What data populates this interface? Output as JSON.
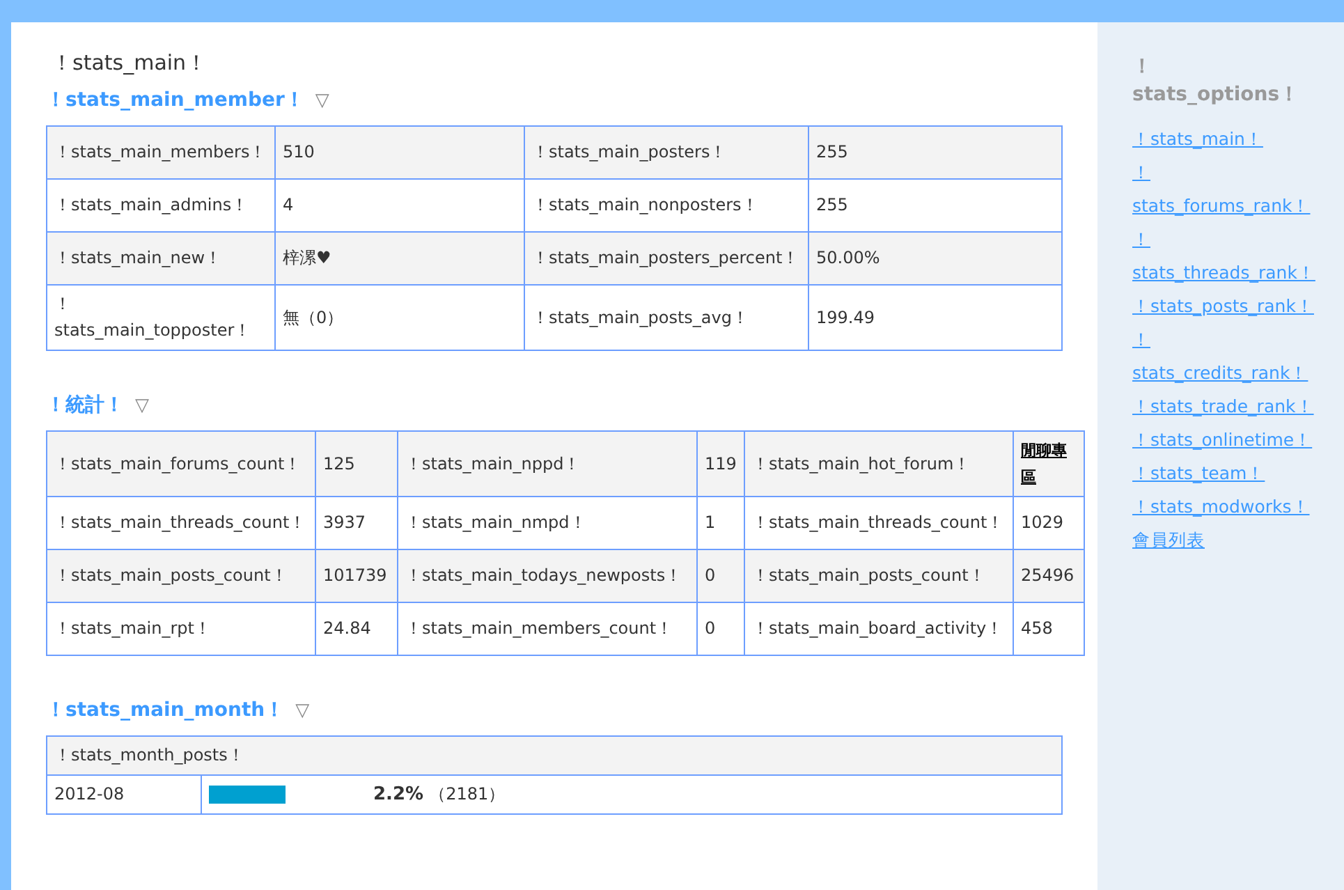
{
  "page_title": "！stats_main！",
  "member_section": {
    "title": "！stats_main_member！",
    "toggle": "▽",
    "rows": [
      [
        "！stats_main_members！",
        "510",
        "！stats_main_posters！",
        "255"
      ],
      [
        "！stats_main_admins！",
        "4",
        "！stats_main_nonposters！",
        "255"
      ],
      [
        "！stats_main_new！",
        "梓漯♥",
        "！stats_main_posters_percent！",
        "50.00%"
      ],
      [
        "！stats_main_topposter！",
        "無（0）",
        "！stats_main_posts_avg！",
        "199.49"
      ]
    ]
  },
  "stats_section": {
    "title": "！統計！",
    "toggle": "▽",
    "rows": [
      [
        {
          "text": "！stats_main_forums_count！"
        },
        {
          "text": "125"
        },
        {
          "text": "！stats_main_nppd！"
        },
        {
          "text": "119"
        },
        {
          "text": "！stats_main_hot_forum！"
        },
        {
          "text": "閒聊專區",
          "kind": "link"
        }
      ],
      [
        {
          "text": "！stats_main_threads_count！"
        },
        {
          "text": "3937"
        },
        {
          "text": "！stats_main_nmpd！"
        },
        {
          "text": "1"
        },
        {
          "text": "！stats_main_threads_count！"
        },
        {
          "text": "1029"
        }
      ],
      [
        {
          "text": "！stats_main_posts_count！"
        },
        {
          "text": "101739"
        },
        {
          "text": "！stats_main_todays_newposts！"
        },
        {
          "text": "0"
        },
        {
          "text": "！stats_main_posts_count！"
        },
        {
          "text": "25496"
        }
      ],
      [
        {
          "text": "！stats_main_rpt！"
        },
        {
          "text": "24.84"
        },
        {
          "text": "！stats_main_members_count！"
        },
        {
          "text": "0"
        },
        {
          "text": "！stats_main_board_activity！"
        },
        {
          "text": "458"
        }
      ]
    ]
  },
  "month_section": {
    "title": "！stats_main_month！",
    "toggle": "▽",
    "header": "！stats_month_posts！",
    "rows": [
      {
        "month": "2012-08",
        "level": 0.1,
        "percent": "2.2%",
        "count": "（2181）"
      }
    ]
  },
  "sidebar": {
    "title": "！stats_options！",
    "links": [
      "！stats_main！",
      "！stats_forums_rank！",
      "！stats_threads_rank！",
      "！stats_posts_rank！",
      "！stats_credits_rank！",
      "！stats_trade_rank！",
      "！stats_onlinetime！",
      "！stats_team！",
      "！stats_modworks！",
      "會員列表"
    ]
  }
}
